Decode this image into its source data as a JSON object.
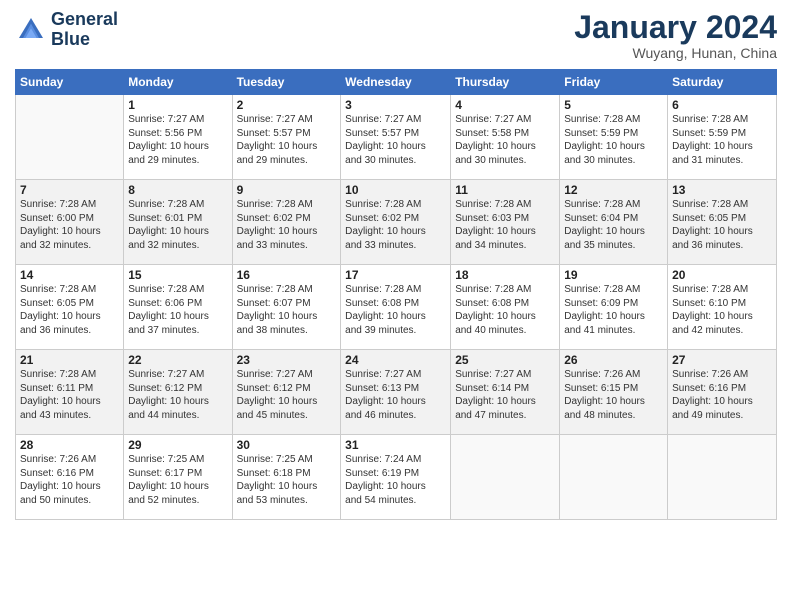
{
  "header": {
    "logo_line1": "General",
    "logo_line2": "Blue",
    "month_title": "January 2024",
    "location": "Wuyang, Hunan, China"
  },
  "days_of_week": [
    "Sunday",
    "Monday",
    "Tuesday",
    "Wednesday",
    "Thursday",
    "Friday",
    "Saturday"
  ],
  "weeks": [
    [
      {
        "day": "",
        "info": ""
      },
      {
        "day": "1",
        "info": "Sunrise: 7:27 AM\nSunset: 5:56 PM\nDaylight: 10 hours\nand 29 minutes."
      },
      {
        "day": "2",
        "info": "Sunrise: 7:27 AM\nSunset: 5:57 PM\nDaylight: 10 hours\nand 29 minutes."
      },
      {
        "day": "3",
        "info": "Sunrise: 7:27 AM\nSunset: 5:57 PM\nDaylight: 10 hours\nand 30 minutes."
      },
      {
        "day": "4",
        "info": "Sunrise: 7:27 AM\nSunset: 5:58 PM\nDaylight: 10 hours\nand 30 minutes."
      },
      {
        "day": "5",
        "info": "Sunrise: 7:28 AM\nSunset: 5:59 PM\nDaylight: 10 hours\nand 30 minutes."
      },
      {
        "day": "6",
        "info": "Sunrise: 7:28 AM\nSunset: 5:59 PM\nDaylight: 10 hours\nand 31 minutes."
      }
    ],
    [
      {
        "day": "7",
        "info": "Sunrise: 7:28 AM\nSunset: 6:00 PM\nDaylight: 10 hours\nand 32 minutes."
      },
      {
        "day": "8",
        "info": "Sunrise: 7:28 AM\nSunset: 6:01 PM\nDaylight: 10 hours\nand 32 minutes."
      },
      {
        "day": "9",
        "info": "Sunrise: 7:28 AM\nSunset: 6:02 PM\nDaylight: 10 hours\nand 33 minutes."
      },
      {
        "day": "10",
        "info": "Sunrise: 7:28 AM\nSunset: 6:02 PM\nDaylight: 10 hours\nand 33 minutes."
      },
      {
        "day": "11",
        "info": "Sunrise: 7:28 AM\nSunset: 6:03 PM\nDaylight: 10 hours\nand 34 minutes."
      },
      {
        "day": "12",
        "info": "Sunrise: 7:28 AM\nSunset: 6:04 PM\nDaylight: 10 hours\nand 35 minutes."
      },
      {
        "day": "13",
        "info": "Sunrise: 7:28 AM\nSunset: 6:05 PM\nDaylight: 10 hours\nand 36 minutes."
      }
    ],
    [
      {
        "day": "14",
        "info": "Sunrise: 7:28 AM\nSunset: 6:05 PM\nDaylight: 10 hours\nand 36 minutes."
      },
      {
        "day": "15",
        "info": "Sunrise: 7:28 AM\nSunset: 6:06 PM\nDaylight: 10 hours\nand 37 minutes."
      },
      {
        "day": "16",
        "info": "Sunrise: 7:28 AM\nSunset: 6:07 PM\nDaylight: 10 hours\nand 38 minutes."
      },
      {
        "day": "17",
        "info": "Sunrise: 7:28 AM\nSunset: 6:08 PM\nDaylight: 10 hours\nand 39 minutes."
      },
      {
        "day": "18",
        "info": "Sunrise: 7:28 AM\nSunset: 6:08 PM\nDaylight: 10 hours\nand 40 minutes."
      },
      {
        "day": "19",
        "info": "Sunrise: 7:28 AM\nSunset: 6:09 PM\nDaylight: 10 hours\nand 41 minutes."
      },
      {
        "day": "20",
        "info": "Sunrise: 7:28 AM\nSunset: 6:10 PM\nDaylight: 10 hours\nand 42 minutes."
      }
    ],
    [
      {
        "day": "21",
        "info": "Sunrise: 7:28 AM\nSunset: 6:11 PM\nDaylight: 10 hours\nand 43 minutes."
      },
      {
        "day": "22",
        "info": "Sunrise: 7:27 AM\nSunset: 6:12 PM\nDaylight: 10 hours\nand 44 minutes."
      },
      {
        "day": "23",
        "info": "Sunrise: 7:27 AM\nSunset: 6:12 PM\nDaylight: 10 hours\nand 45 minutes."
      },
      {
        "day": "24",
        "info": "Sunrise: 7:27 AM\nSunset: 6:13 PM\nDaylight: 10 hours\nand 46 minutes."
      },
      {
        "day": "25",
        "info": "Sunrise: 7:27 AM\nSunset: 6:14 PM\nDaylight: 10 hours\nand 47 minutes."
      },
      {
        "day": "26",
        "info": "Sunrise: 7:26 AM\nSunset: 6:15 PM\nDaylight: 10 hours\nand 48 minutes."
      },
      {
        "day": "27",
        "info": "Sunrise: 7:26 AM\nSunset: 6:16 PM\nDaylight: 10 hours\nand 49 minutes."
      }
    ],
    [
      {
        "day": "28",
        "info": "Sunrise: 7:26 AM\nSunset: 6:16 PM\nDaylight: 10 hours\nand 50 minutes."
      },
      {
        "day": "29",
        "info": "Sunrise: 7:25 AM\nSunset: 6:17 PM\nDaylight: 10 hours\nand 52 minutes."
      },
      {
        "day": "30",
        "info": "Sunrise: 7:25 AM\nSunset: 6:18 PM\nDaylight: 10 hours\nand 53 minutes."
      },
      {
        "day": "31",
        "info": "Sunrise: 7:24 AM\nSunset: 6:19 PM\nDaylight: 10 hours\nand 54 minutes."
      },
      {
        "day": "",
        "info": ""
      },
      {
        "day": "",
        "info": ""
      },
      {
        "day": "",
        "info": ""
      }
    ]
  ]
}
